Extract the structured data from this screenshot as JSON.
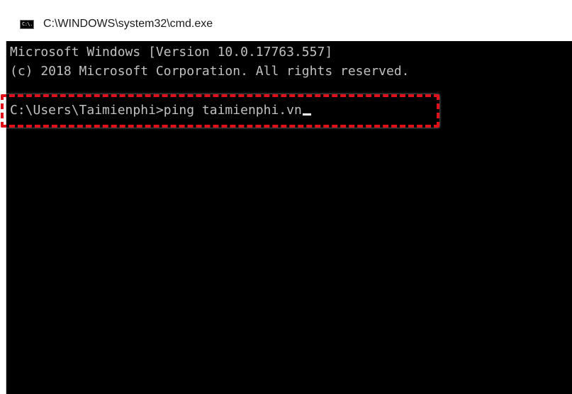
{
  "window": {
    "title": "C:\\WINDOWS\\system32\\cmd.exe",
    "icon": "cmd-icon",
    "icon_text": "C:\\."
  },
  "console": {
    "lines": [
      "Microsoft Windows [Version 10.0.17763.557]",
      "(c) 2018 Microsoft Corporation. All rights reserved.",
      "",
      "C:\\Users\\Taimienphi>ping taimienphi.vn"
    ],
    "background_color": "#000000",
    "text_color": "#c0c0c0"
  },
  "annotation": {
    "highlight_color": "#e0101a",
    "style": "dashed"
  }
}
